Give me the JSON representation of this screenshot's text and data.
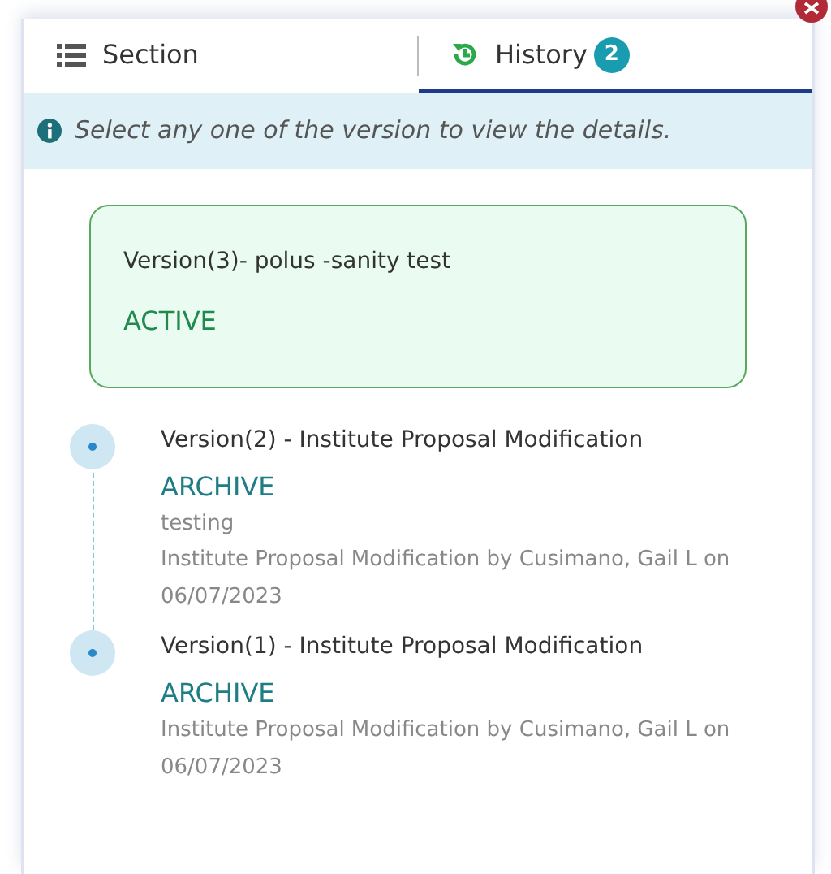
{
  "tabs": [
    {
      "kind": "list",
      "label": "Section",
      "selected": false
    },
    {
      "kind": "history",
      "label": "History",
      "badge": "2",
      "selected": true
    }
  ],
  "info": "Select any one of the version to view the details.",
  "current": {
    "title": "Version(3)- polus -sanity test",
    "status": "ACTIVE"
  },
  "versions": [
    {
      "title": "Version(2) - Institute Proposal Modification",
      "status": "ARCHIVE",
      "comment": "testing",
      "meta": "Institute Proposal Modification by Cusimano, Gail L on 06/07/2023"
    },
    {
      "title": "Version(1) - Institute Proposal Modification",
      "status": "ARCHIVE",
      "meta": "Institute Proposal Modification by Cusimano, Gail L on 06/07/2023"
    }
  ]
}
